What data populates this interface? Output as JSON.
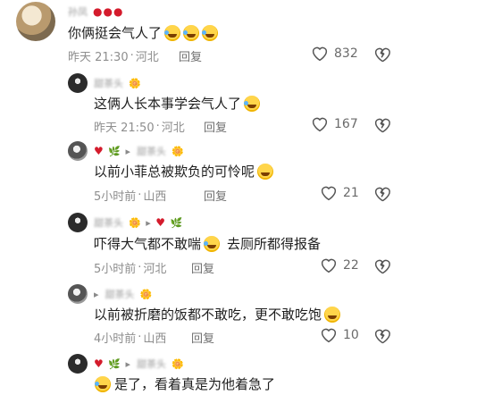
{
  "comments": [
    {
      "name": "孙凤",
      "name_suffix": "",
      "body": "你俩挺会气人了",
      "emoji_count": 3,
      "time": "昨天 21:30",
      "location": "河北",
      "reply": "回复",
      "likes": "832"
    },
    {
      "name": "甜茶头",
      "name_suffix": "",
      "body": "这俩人长本事学会气人了",
      "emoji_count": 1,
      "time": "昨天 21:50",
      "location": "河北",
      "reply": "回复",
      "likes": "167"
    },
    {
      "name": "甜茶头",
      "name_suffix": "",
      "body": "以前小菲总被欺负的可怜呢",
      "emoji_count": 1,
      "time": "5小时前",
      "location": "山西",
      "reply": "回复",
      "likes": "21"
    },
    {
      "name": "甜茶头",
      "name_suffix": "",
      "body_part1": "吓得大气都不敢喘",
      "body_part2": "去厕所都得报备",
      "time": "5小时前",
      "location": "河北",
      "reply": "回复",
      "likes": "22"
    },
    {
      "name": "甜茶头",
      "name_suffix": "",
      "body": "以前被折磨的饭都不敢吃，更不敢吃饱",
      "emoji_count": 1,
      "time": "4小时前",
      "location": "山西",
      "reply": "回复",
      "likes": "10"
    },
    {
      "name": "甜茶头",
      "name_suffix": "",
      "body": "是了，看着真是为他着急了",
      "time": "",
      "location": ""
    }
  ],
  "sep": "·",
  "icons": {
    "like": "heart-outline-icon",
    "dislike": "broken-heart-icon"
  }
}
